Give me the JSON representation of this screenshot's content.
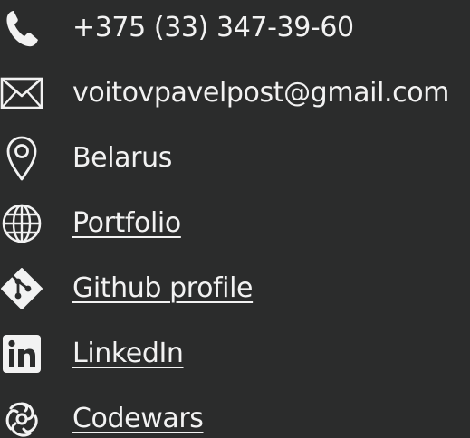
{
  "theme": {
    "background": "#2b2c2c",
    "text": "#f2f2f2"
  },
  "contacts": [
    {
      "icon": "phone-icon",
      "text": "+375 (33) 347-39-60"
    },
    {
      "icon": "mail-icon",
      "text": "voitovpavelpost@gmail.com"
    },
    {
      "icon": "location-pin-icon",
      "text": "Belarus"
    },
    {
      "icon": "globe-icon",
      "text": "Portfolio"
    },
    {
      "icon": "git-icon",
      "text": "Github profile"
    },
    {
      "icon": "linkedin-icon",
      "text": "LinkedIn"
    },
    {
      "icon": "codewars-icon",
      "text": "Codewars"
    }
  ]
}
